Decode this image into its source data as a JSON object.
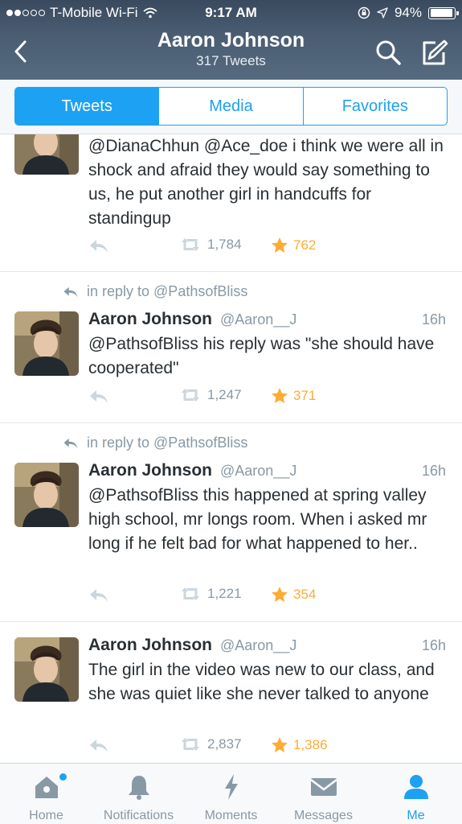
{
  "status_bar": {
    "carrier": "T-Mobile Wi-Fi",
    "time": "9:17 AM",
    "battery": "94%",
    "battery_level": 0.94
  },
  "header": {
    "title": "Aaron Johnson",
    "subtitle": "317 Tweets"
  },
  "tabs": [
    "Tweets",
    "Media",
    "Favorites"
  ],
  "tweets": [
    {
      "text": "@DianaChhun @Ace_doe i think we were all in shock and afraid they would say something to us, he put another girl in handcuffs for standingup",
      "retweets": "1,784",
      "favorites": "762"
    },
    {
      "reply_to": "in reply to @PathsofBliss",
      "name": "Aaron Johnson",
      "handle": "@Aaron__J",
      "time": "16h",
      "text": "@PathsofBliss his reply was \"she should have cooperated\"",
      "retweets": "1,247",
      "favorites": "371"
    },
    {
      "reply_to": "in reply to @PathsofBliss",
      "name": "Aaron Johnson",
      "handle": "@Aaron__J",
      "time": "16h",
      "text": "@PathsofBliss this happened at spring valley high school, mr longs room. When i asked mr long if he felt bad for what happened to her..",
      "retweets": "1,221",
      "favorites": "354"
    },
    {
      "name": "Aaron Johnson",
      "handle": "@Aaron__J",
      "time": "16h",
      "text": "The girl in the video was new to our class, and she was quiet like she never talked to anyone",
      "retweets": "2,837",
      "favorites": "1,386"
    }
  ],
  "tabbar": [
    "Home",
    "Notifications",
    "Moments",
    "Messages",
    "Me"
  ],
  "colors": {
    "accent": "#1da1f2",
    "favorite": "#ffac33",
    "muted": "#8899a6"
  }
}
